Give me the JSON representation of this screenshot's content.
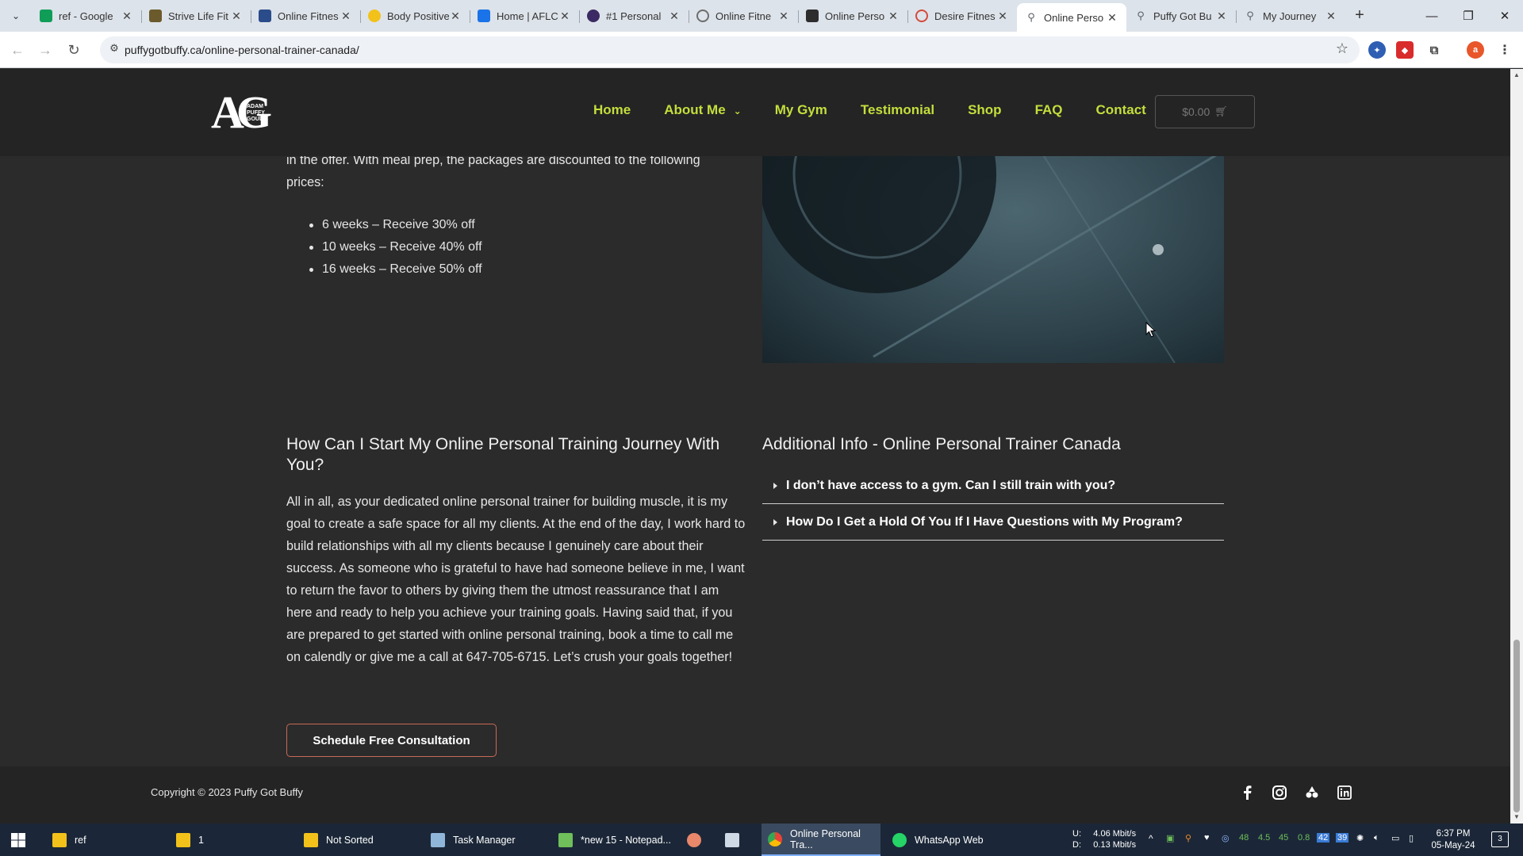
{
  "browser": {
    "tabs": [
      {
        "title": "ref - Google",
        "favicon": "sheets-icon",
        "color": "#0f9d58"
      },
      {
        "title": "Strive Life Fit",
        "favicon": "cup-icon",
        "color": "#6b5a2b"
      },
      {
        "title": "Online Fitnes",
        "favicon": "check-icon",
        "color": "#2b4c8a"
      },
      {
        "title": "Body Positive",
        "favicon": "emoji-icon",
        "color": "#f2c21b"
      },
      {
        "title": "Home | AFLC",
        "favicon": "list-icon",
        "color": "#1a73e8"
      },
      {
        "title": "#1 Personal",
        "favicon": "shield-icon",
        "color": "#3b2a63"
      },
      {
        "title": "Online Fitne",
        "favicon": "circle-icon",
        "color": "#6d6d6d"
      },
      {
        "title": "Online Perso",
        "favicon": "mark-icon",
        "color": "#2d2d2d"
      },
      {
        "title": "Desire Fitnes",
        "favicon": "loop-icon",
        "color": "#d34a3c"
      },
      {
        "title": "Online Perso",
        "favicon": "runner-icon",
        "color": "#5f6368",
        "active": true
      },
      {
        "title": "Puffy Got Bu",
        "favicon": "runner-icon",
        "color": "#5f6368"
      },
      {
        "title": "My Journey",
        "favicon": "runner-icon",
        "color": "#5f6368"
      }
    ],
    "url": "puffygotbuffy.ca/online-personal-trainer-canada/",
    "profile_initial": "a"
  },
  "site": {
    "logo": {
      "big": "AG",
      "small": "ADAM\nPUFFY\nGOULD"
    },
    "nav": [
      "Home",
      "About Me",
      "My Gym",
      "Testimonial",
      "Shop",
      "FAQ",
      "Contact"
    ],
    "cart": "$0.00",
    "offer_text": "in the offer. With meal prep, the packages are discounted to the following prices:",
    "prices": [
      "6 weeks – Receive 30% off",
      "10 weeks – Receive 40% off",
      "16 weeks – Receive 50% off"
    ],
    "left_title": "How Can I Start My Online Personal Training Journey With You?",
    "left_paragraph": "All in all, as your dedicated online personal trainer for building muscle, it is my goal to create a safe space for all my clients. At the end of the day, I work hard to build relationships with all my clients because I genuinely care about their success. As someone who is grateful to have had someone believe in me, I want to return the favor to others by giving them the utmost reassurance that I am here and ready to help you achieve your training goals. Having said that, if you are prepared to get started with online personal training, book a time to call me on calendly or give me a call at 647-705-6715. Let’s crush your goals together!",
    "cta": "Schedule Free Consultation",
    "right_title": "Additional Info - Online Personal Trainer Canada",
    "faq": [
      "I don’t have access to a gym. Can I still train with you?",
      "How Do I Get a Hold Of You If I Have Questions with My Program?"
    ],
    "copyright": "Copyright © 2023 Puffy Got Buffy",
    "social": [
      "facebook-icon",
      "instagram-icon",
      "tiktok-icon",
      "linkedin-icon"
    ],
    "accent_color": "#c4de3c"
  },
  "taskbar": {
    "items": [
      {
        "label": "ref",
        "icon": "folder-icon"
      },
      {
        "label": "1",
        "icon": "folder-icon"
      },
      {
        "label": "Not Sorted",
        "icon": "folder-icon"
      },
      {
        "label": "Task Manager",
        "icon": "task-manager-icon"
      },
      {
        "label": "*new 15 - Notepad...",
        "icon": "notepad-icon"
      },
      {
        "label": "",
        "icon": "app-icon"
      },
      {
        "label": "",
        "icon": "document-icon"
      },
      {
        "label": "Online Personal Tra...",
        "icon": "chrome-icon",
        "active": true
      },
      {
        "label": "WhatsApp Web",
        "icon": "whatsapp-icon"
      }
    ],
    "net_up_label": "U:",
    "net_down_label": "D:",
    "net_up": "4.06 Mbit/s",
    "net_down": "0.13 Mbit/s",
    "tray_values": [
      "48",
      "4.5",
      "45",
      "0.8"
    ],
    "tray_badges": [
      "42",
      "39"
    ],
    "time": "6:37 PM",
    "date": "05-May-24",
    "notifications": "3"
  }
}
